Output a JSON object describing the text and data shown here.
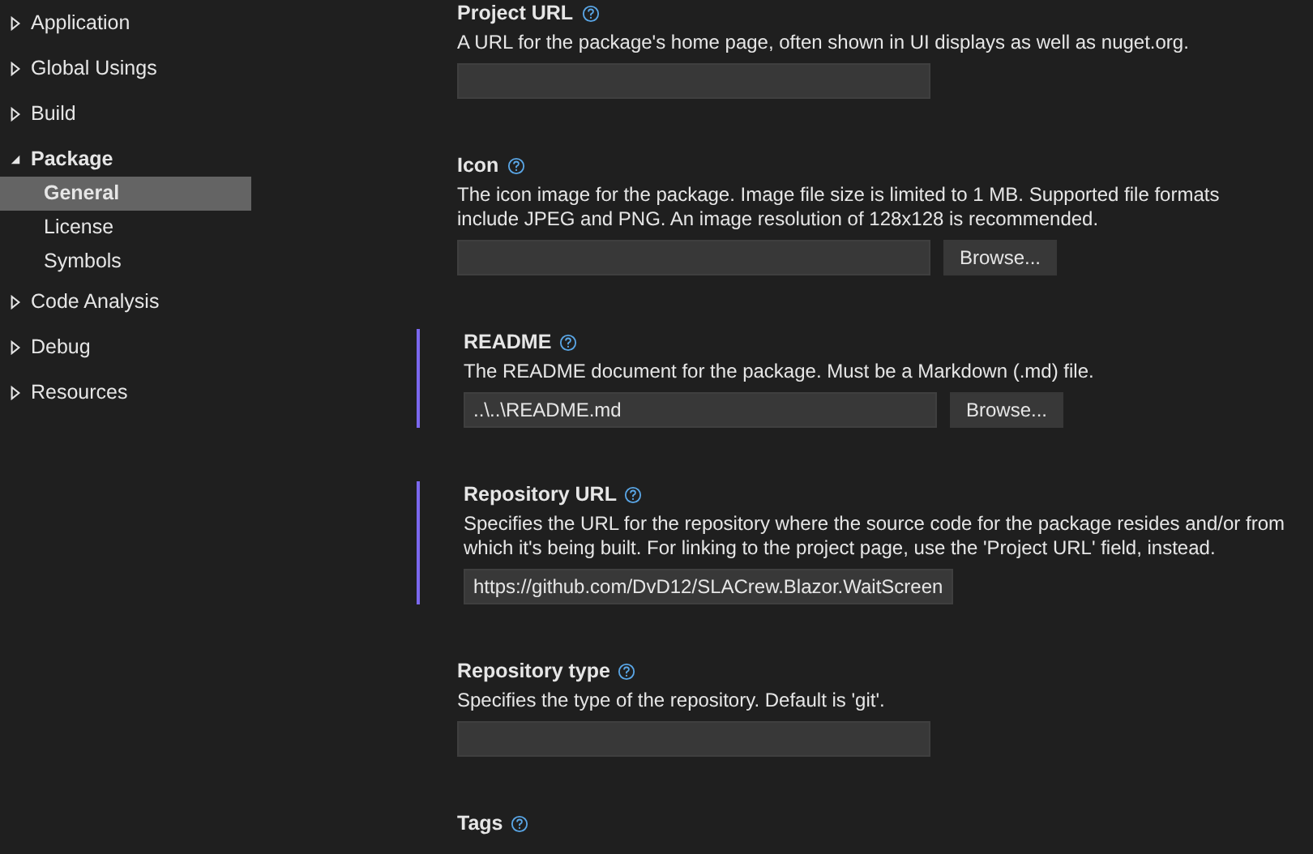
{
  "sidebar": {
    "items": [
      {
        "label": "Application",
        "expanded": false
      },
      {
        "label": "Global Usings",
        "expanded": false
      },
      {
        "label": "Build",
        "expanded": false
      },
      {
        "label": "Package",
        "expanded": true,
        "children": [
          {
            "label": "General",
            "selected": true
          },
          {
            "label": "License",
            "selected": false
          },
          {
            "label": "Symbols",
            "selected": false
          }
        ]
      },
      {
        "label": "Code Analysis",
        "expanded": false
      },
      {
        "label": "Debug",
        "expanded": false
      },
      {
        "label": "Resources",
        "expanded": false
      }
    ]
  },
  "settings": [
    {
      "title": "Project URL",
      "description": "A URL for the package's home page, often shown in UI displays as well as nuget.org.",
      "modified": false,
      "field": {
        "kind": "text"
      }
    },
    {
      "title": "Icon",
      "description": "The icon image for the package. Image file size is limited to 1 MB. Supported file formats include JPEG and PNG. An image resolution of 128x128 is recommended.",
      "modified": false,
      "field": {
        "kind": "text"
      },
      "button": "Browse..."
    },
    {
      "title": "README",
      "description": "The README document for the package. Must be a Markdown (.md) file.",
      "modified": true,
      "field": {
        "kind": "text",
        "value": "..\\..\\README.md"
      },
      "button": "Browse..."
    },
    {
      "title": "Repository URL",
      "description": "Specifies the URL for the repository where the source code for the package resides and/or from which it's being built. For linking to the project page, use the 'Project URL' field, instead.",
      "modified": true,
      "field": {
        "kind": "text",
        "value": "https://github.com/DvD12/SLACrew.Blazor.WaitScreen"
      }
    },
    {
      "title": "Repository type",
      "description": "Specifies the type of the repository. Default is 'git'.",
      "modified": false,
      "field": {
        "kind": "text"
      }
    },
    {
      "title": "Tags",
      "modified": false
    }
  ]
}
